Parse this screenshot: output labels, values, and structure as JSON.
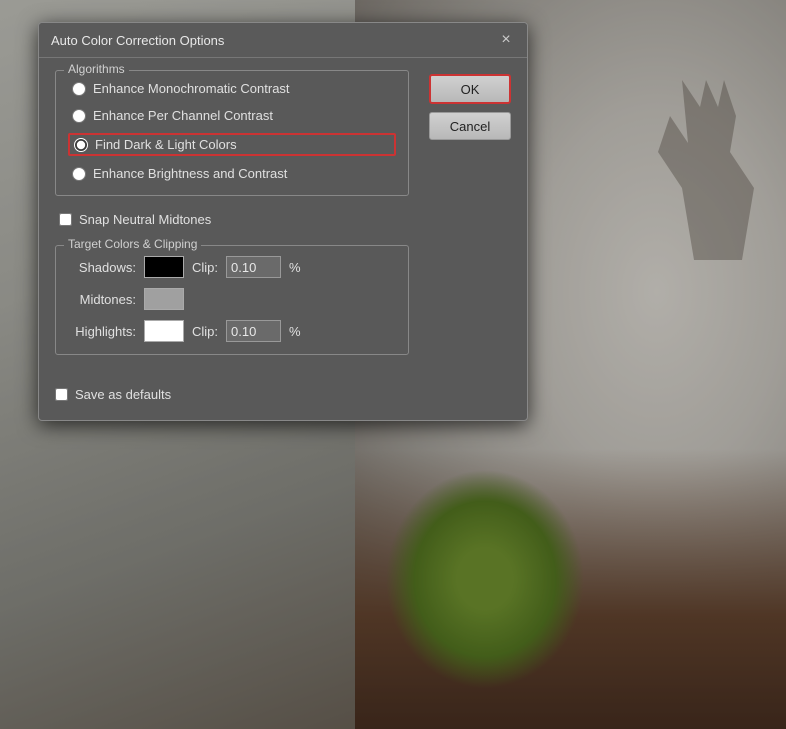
{
  "background": {
    "alt": "Tulips photo background"
  },
  "dialog": {
    "title": "Auto Color Correction Options",
    "close_button": "×",
    "algorithms_group_label": "Algorithms",
    "radio_options": [
      {
        "id": "opt1",
        "label": "Enhance Monochromatic Contrast",
        "checked": false
      },
      {
        "id": "opt2",
        "label": "Enhance Per Channel Contrast",
        "checked": false
      },
      {
        "id": "opt3",
        "label": "Find Dark & Light Colors",
        "checked": true
      },
      {
        "id": "opt4",
        "label": "Enhance Brightness and Contrast",
        "checked": false
      }
    ],
    "snap_neutral": {
      "label": "Snap Neutral Midtones",
      "checked": false
    },
    "target_group_label": "Target Colors & Clipping",
    "color_rows": [
      {
        "label": "Shadows:",
        "swatch_color": "#000000",
        "has_clip": true,
        "clip_value": "0.10",
        "percent": "%"
      },
      {
        "label": "Midtones:",
        "swatch_color": "#a0a0a0",
        "has_clip": false,
        "clip_value": null,
        "percent": null
      },
      {
        "label": "Highlights:",
        "swatch_color": "#ffffff",
        "has_clip": true,
        "clip_value": "0.10",
        "percent": "%"
      }
    ],
    "save_defaults": {
      "label": "Save as defaults",
      "checked": false
    },
    "ok_label": "OK",
    "cancel_label": "Cancel"
  }
}
